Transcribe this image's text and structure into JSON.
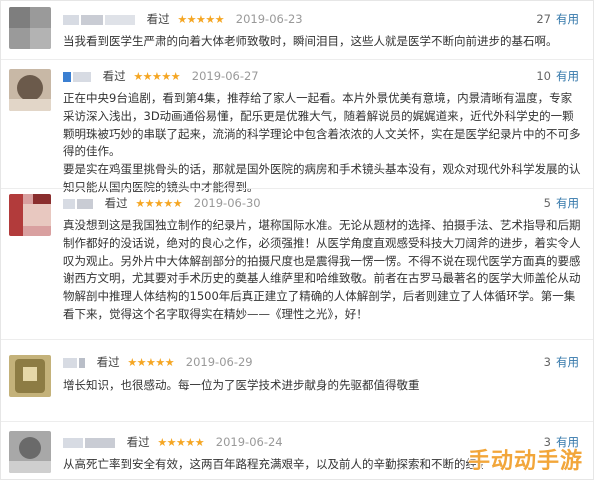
{
  "reviews": [
    {
      "seen_label": "看过",
      "stars": "★★★★★",
      "date": "2019-06-23",
      "useful_count": "27",
      "useful_label": "有用",
      "text": "当我看到医学生严肃的向着大体老师致敬时，瞬间泪目，这些人就是医学不断向前进步的基石啊。"
    },
    {
      "seen_label": "看过",
      "stars": "★★★★★",
      "date": "2019-06-27",
      "useful_count": "10",
      "useful_label": "有用",
      "text": "正在中央9台追剧，看到第4集，推荐给了家人一起看。本片外景优美有意境，内景清晰有温度，专家采访深入浅出，3D动画通俗易懂，配乐更是优雅大气，随着解说员的娓娓道来，近代外科学史的一颗颗明珠被巧妙的串联了起来，流淌的科学理论中包含着浓浓的人文关怀，实在是医学纪录片中的不可多得的佳作。\n要是实在鸡蛋里挑骨头的话，那就是国外医院的病房和手术镜头基本没有，观众对现代外科学发展的认知只能从国内医院的镜头中才能得到。"
    },
    {
      "seen_label": "看过",
      "stars": "★★★★★",
      "date": "2019-06-30",
      "useful_count": "5",
      "useful_label": "有用",
      "text": "真没想到这是我国独立制作的纪录片，堪称国际水准。无论从题材的选择、拍摄手法、艺术指导和后期制作都好的没话说，绝对的良心之作，必须强推！从医学角度直观感受科技大刀阔斧的进步，着实令人叹为观止。另外片中大体解剖部分的拍摄尺度也是震得我一愣一愣。不得不说在现代医学方面真的要感谢西方文明，尤其要对手术历史的奠基人维萨里和哈维致敬。前者在古罗马最著名的医学大师盖伦从动物解剖中推理人体结构的1500年后真正建立了精确的人体解剖学，后者则建立了人体循环学。第一集看下来，觉得这个名字取得实在精妙——《理性之光》，好！"
    },
    {
      "seen_label": "看过",
      "stars": "★★★★★",
      "date": "2019-06-29",
      "useful_count": "3",
      "useful_label": "有用",
      "text": "增长知识，也很感动。每一位为了医学技术进步献身的先驱都值得敬重"
    },
    {
      "seen_label": "看过",
      "stars": "★★★★★",
      "date": "2019-06-24",
      "useful_count": "3",
      "useful_label": "有用",
      "text": "从高死亡率到安全有效，这两百年路程充满艰辛，以及前人的辛勤探索和不断的经验总"
    }
  ],
  "watermark": "手动动手游",
  "colors": {
    "star": "#f5a623",
    "useful_link": "#3377aa",
    "date": "#999999",
    "watermark": "#f2a63a"
  }
}
